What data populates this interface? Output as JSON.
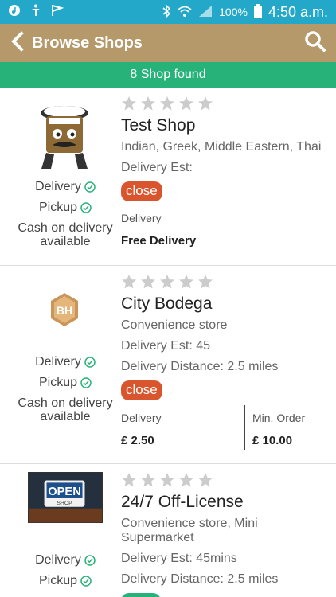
{
  "status_bar": {
    "battery": "100%",
    "time": "4:50 a.m.",
    "icons": [
      "music-icon",
      "accessibility-icon",
      "flag-icon",
      "bluetooth-icon",
      "wifi-icon",
      "signal-icon",
      "battery-icon"
    ]
  },
  "app_bar": {
    "title": "Browse Shops",
    "back_icon": "chevron-left-icon",
    "search_icon": "search-icon"
  },
  "found_bar": {
    "text": "8 Shop found"
  },
  "colors": {
    "status_bar": "#23a8c9",
    "app_bar": "#b5996a",
    "found_bar": "#27b27a",
    "closed_badge": "#d9552e",
    "open_badge": "#27b27a"
  },
  "shops": [
    {
      "name": "Test Shop",
      "category": "Indian, Greek, Middle Eastern, Thai",
      "delivery_est": "Delivery Est:",
      "status": "close",
      "rating": 0,
      "services": {
        "delivery": "Delivery",
        "pickup": "Pickup",
        "cod": "Cash on delivery available"
      },
      "delivery_label": "Delivery",
      "delivery_value": "Free Delivery"
    },
    {
      "name": "City Bodega",
      "category": "Convenience store",
      "delivery_est": "Delivery Est: 45",
      "delivery_distance": "Delivery Distance: 2.5 miles",
      "status": "close",
      "rating": 0,
      "services": {
        "delivery": "Delivery",
        "pickup": "Pickup",
        "cod": "Cash on delivery available"
      },
      "delivery_label": "Delivery",
      "delivery_value": "£ 2.50",
      "min_order_label": "Min. Order",
      "min_order_value": "£ 10.00",
      "logo_text": "BH"
    },
    {
      "name": "24/7 Off-License",
      "category": "Convenience store, Mini Supermarket",
      "delivery_est": "Delivery Est: 45mins",
      "delivery_distance": "Delivery Distance: 2.5 miles",
      "status": "open",
      "rating": 0,
      "services": {
        "delivery": "Delivery",
        "pickup": "Pickup"
      },
      "logo_text": "OPEN",
      "logo_subtext": "SHOP"
    }
  ]
}
